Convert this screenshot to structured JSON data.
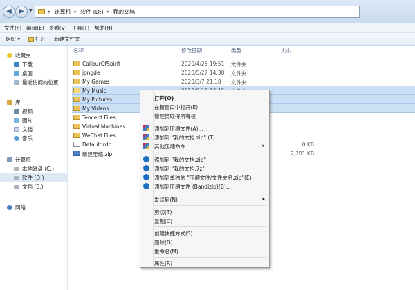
{
  "address": {
    "crumbs": [
      "计算机",
      "软件 (D:)",
      "我的文档"
    ]
  },
  "menubar": [
    "文件(F)",
    "编辑(E)",
    "查看(V)",
    "工具(T)",
    "帮助(H)"
  ],
  "toolbar": {
    "organize": "组织 ▾",
    "open": "打开",
    "new_folder": "新建文件夹"
  },
  "nav": {
    "favorites": "收藏夹",
    "downloads": "下载",
    "desktop": "桌面",
    "recent": "最近访问的位置",
    "libraries": "库",
    "videos": "视频",
    "pictures": "图片",
    "documents": "文档",
    "music": "音乐",
    "computer": "计算机",
    "drive_c": "本地磁盘 (C:)",
    "drive_d": "软件 (D:)",
    "drive_e": "文档 (E:)",
    "network": "网络"
  },
  "columns": {
    "name": "名称",
    "modified": "修改日期",
    "type": "类型",
    "size": "大小"
  },
  "files": [
    {
      "name": "CaliburOfSpirit",
      "date": "2020/4/25 19:51",
      "type": "文件夹",
      "size": ""
    },
    {
      "name": "jongde",
      "date": "2020/5/27 14:38",
      "type": "文件夹",
      "size": ""
    },
    {
      "name": "My Games",
      "date": "2020/3/7 21:18",
      "type": "文件夹",
      "size": ""
    },
    {
      "name": "My Music",
      "date": "2018/9/11 14:15",
      "type": "文件夹",
      "size": ""
    },
    {
      "name": "My Pictures",
      "date": "",
      "type": "",
      "size": ""
    },
    {
      "name": "My Videos",
      "date": "",
      "type": "",
      "size": ""
    },
    {
      "name": "Tencent Files",
      "date": "",
      "type": "",
      "size": ""
    },
    {
      "name": "Virtual Machines",
      "date": "",
      "type": "",
      "size": ""
    },
    {
      "name": "WeChat Files",
      "date": "",
      "type": "",
      "size": ""
    },
    {
      "name": "Default.rdp",
      "date": "",
      "type": "",
      "size": "0 KB"
    },
    {
      "name": "新建压缩.zip",
      "date": "",
      "type": "",
      "size": "2,201 KB"
    }
  ],
  "context_menu": {
    "open": "打开(O)",
    "open_new_window": "在新窗口中打开(E)",
    "admin_owner": "管理员取得所有权",
    "add_archive": "添加到压缩文件(A)...",
    "add_zip": "添加到 \"我的文档.zip\" (T)",
    "other_cmds": "其他压缩命令",
    "bandi_zip": "添加到 \"我的文档.zip\"",
    "bandi_7z": "添加到 \"我的文档.7z\"",
    "bandi_separate": "添加到单独的 \"压缩文件/文件夹名.zip\"(E)",
    "bandi_archive": "添加到压缩文件 (Bandizip)(B)...",
    "send_to": "发送到(N)",
    "cut": "剪切(T)",
    "copy": "复制(C)",
    "shortcut": "创建快捷方式(S)",
    "delete": "删除(D)",
    "rename": "重命名(M)",
    "properties": "属性(R)"
  }
}
